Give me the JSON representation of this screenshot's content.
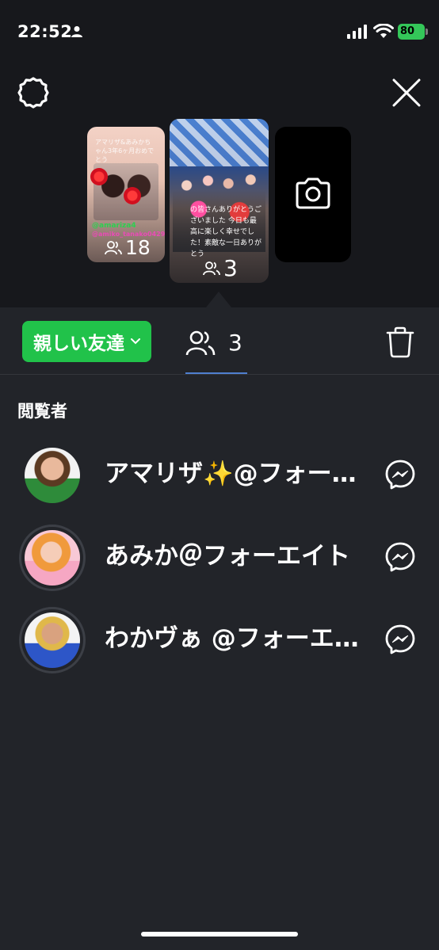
{
  "status_bar": {
    "time": "22:52",
    "battery": "80"
  },
  "stories": {
    "previous": {
      "caption": "アマリザ&あみかちゃん3年6ヶ月おめでとう",
      "handle_1": "@amariza4",
      "handle_2": "@amiko_tanako0429",
      "viewer_count": "18"
    },
    "current": {
      "caption": "の皆さんありがとうございました 今日も最高に楽しく幸せでした！素敵な一日ありがとう",
      "viewer_count": "3"
    },
    "add_icon": "camera-icon"
  },
  "audience": {
    "label": "親しい友達",
    "viewers_tab_count": "3"
  },
  "viewers_section": {
    "title": "閲覧者",
    "items": [
      {
        "name": "アマリザ✨@フォーエイト",
        "action_icon": "messenger-icon"
      },
      {
        "name": "あみか＠フォーエイト",
        "action_icon": "messenger-icon"
      },
      {
        "name": "わかヴぁ @フォーエイト",
        "action_icon": "messenger-icon"
      }
    ]
  },
  "colors": {
    "background": "#222429",
    "top_background": "#17181c",
    "accent_green": "#21c24a",
    "tab_underline": "#4f7fd0",
    "battery_green": "#34c759"
  }
}
